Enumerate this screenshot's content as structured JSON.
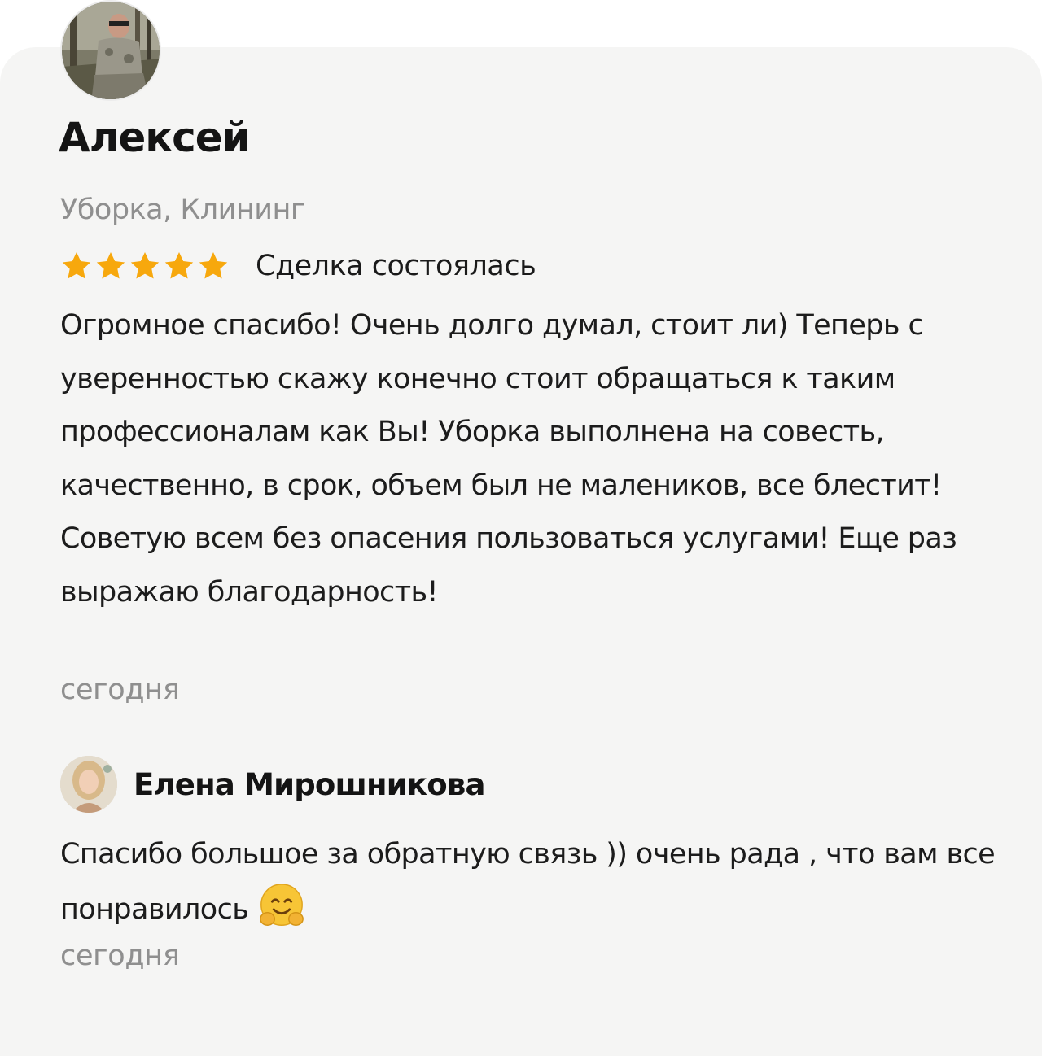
{
  "review": {
    "author": "Алексей",
    "avatar_icon": "user-photo-avatar",
    "category": "Уборка, Клининг",
    "rating": 5,
    "rating_max": 5,
    "star_color": "#f7a80d",
    "deal_status": "Сделка состоялась",
    "text": "Огромное спасибо! Очень долго думал, стоит ли) Теперь с уверенностью скажу конечно стоит обращаться к таким профессионалам как Вы! Уборка выполнена на совесть, качественно, в срок, объем был не малеников, все блестит! Советую всем без опасения пользоваться услугами! Еще раз выражаю благодарность!",
    "date": "сегодня"
  },
  "reply": {
    "author": "Елена Мирошникова",
    "avatar_icon": "user-photo-avatar",
    "text": "Спасибо большое за обратную связь )) очень рада , что вам все понравилось",
    "emoji_icon": "hugging-face-icon",
    "date": "сегодня"
  },
  "colors": {
    "card_background": "#f5f5f4",
    "muted_text": "#8f8f8f"
  }
}
